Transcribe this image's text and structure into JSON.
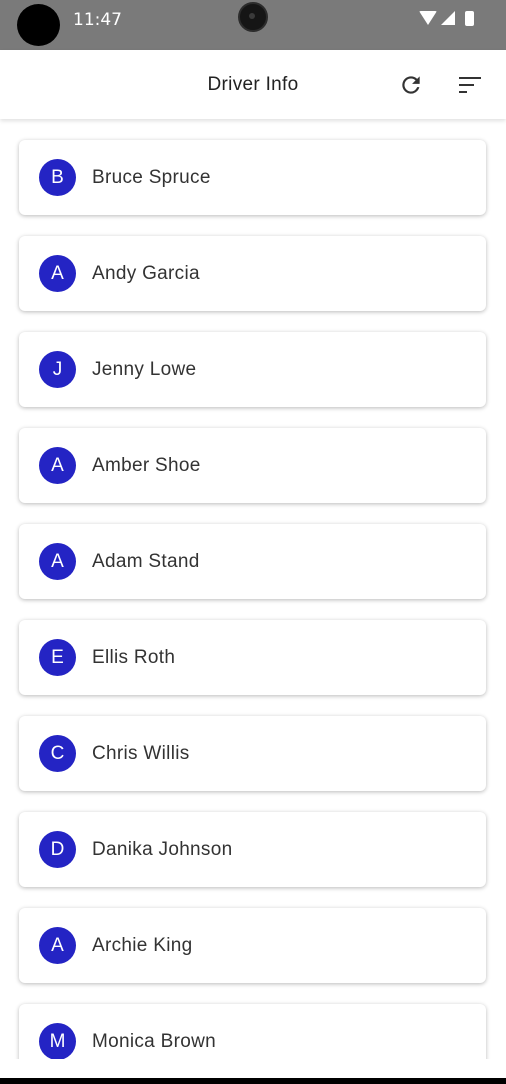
{
  "status_bar": {
    "time": "11:47",
    "icons": [
      "wifi-icon",
      "cell-signal-icon",
      "battery-icon"
    ]
  },
  "app_bar": {
    "title": "Driver Info",
    "actions": [
      {
        "name": "refresh-icon"
      },
      {
        "name": "sort-icon"
      }
    ]
  },
  "colors": {
    "avatar_bg": "#2424c4",
    "status_bar_bg": "#7a7a7a"
  },
  "drivers": [
    {
      "initial": "B",
      "name": "Bruce Spruce"
    },
    {
      "initial": "A",
      "name": "Andy Garcia"
    },
    {
      "initial": "J",
      "name": "Jenny Lowe"
    },
    {
      "initial": "A",
      "name": "Amber Shoe"
    },
    {
      "initial": "A",
      "name": "Adam Stand"
    },
    {
      "initial": "E",
      "name": "Ellis Roth"
    },
    {
      "initial": "C",
      "name": "Chris Willis"
    },
    {
      "initial": "D",
      "name": "Danika Johnson"
    },
    {
      "initial": "A",
      "name": "Archie King"
    },
    {
      "initial": "M",
      "name": "Monica Brown"
    }
  ]
}
